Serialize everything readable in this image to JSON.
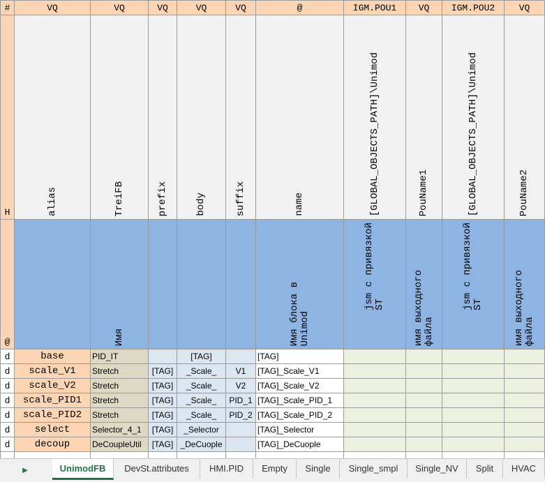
{
  "row1": {
    "head": "#",
    "cols": [
      "VQ",
      "VQ",
      "VQ",
      "VQ",
      "VQ",
      "@",
      "IGM.POU1",
      "VQ",
      "IGM.POU2",
      "VQ"
    ]
  },
  "row2": {
    "head": "H",
    "cols": [
      "alias",
      "TreiFB",
      "prefix",
      "body",
      "suffix",
      "name",
      "[GLOBAL_OBJECTS_PATH]\\Unimod",
      "PouName1",
      "[GLOBAL_OBJECTS_PATH]\\Unimod",
      "PouName2"
    ]
  },
  "row3": {
    "head": "@",
    "treifb_desc": "Имя",
    "name_desc": "Имя блока в\nUnimod",
    "pou1_desc": "jsm с привязкой\nST",
    "pouname1_desc": "имя выходного\nфайла",
    "pou2_desc": "jsm с привязкой\nST",
    "pouname2_desc": "имя выходного\nфайла"
  },
  "rows": [
    {
      "d": "d",
      "alias": "base",
      "treifb": "PID_IT",
      "prefix": "",
      "body": "[TAG]",
      "suffix": "",
      "name": "[TAG]"
    },
    {
      "d": "d",
      "alias": "scale_V1",
      "treifb": "Stretch",
      "prefix": "[TAG]",
      "body": "_Scale_",
      "suffix": "V1",
      "name": "[TAG]_Scale_V1"
    },
    {
      "d": "d",
      "alias": "scale_V2",
      "treifb": "Stretch",
      "prefix": "[TAG]",
      "body": "_Scale_",
      "suffix": "V2",
      "name": "[TAG]_Scale_V2"
    },
    {
      "d": "d",
      "alias": "scale_PID1",
      "treifb": "Stretch",
      "prefix": "[TAG]",
      "body": "_Scale_",
      "suffix": "PID_1",
      "name": "[TAG]_Scale_PID_1"
    },
    {
      "d": "d",
      "alias": "scale_PID2",
      "treifb": "Stretch",
      "prefix": "[TAG]",
      "body": "_Scale_",
      "suffix": "PID_2",
      "name": "[TAG]_Scale_PID_2"
    },
    {
      "d": "d",
      "alias": "select",
      "treifb": "Selector_4_1",
      "prefix": "[TAG]",
      "body": "_Selector",
      "suffix": "",
      "name": "[TAG]_Selector"
    },
    {
      "d": "d",
      "alias": "decoup",
      "treifb": "DeCoupleUtil",
      "prefix": "[TAG]",
      "body": "_DeCuople",
      "suffix": "",
      "name": "[TAG]_DeCuople"
    }
  ],
  "tabs": [
    {
      "label": "UnimodFB",
      "active": true
    },
    {
      "label": "DevSt.attributes"
    },
    {
      "label": "HMI.PID"
    },
    {
      "label": "Empty"
    },
    {
      "label": "Single"
    },
    {
      "label": "Single_smpl"
    },
    {
      "label": "Single_NV"
    },
    {
      "label": "Split"
    },
    {
      "label": "HVAC"
    }
  ],
  "nav_icon": "triangle-right-icon"
}
